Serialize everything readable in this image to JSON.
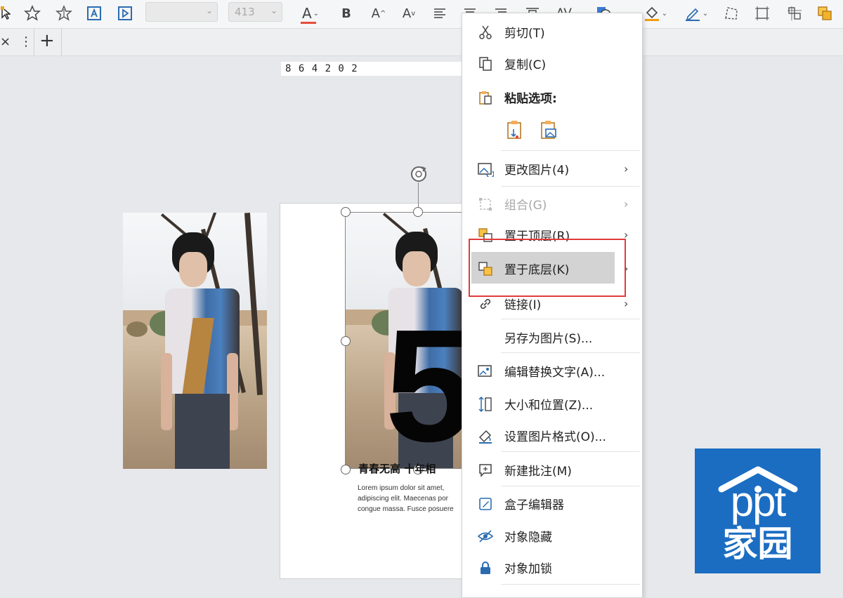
{
  "toolbar": {
    "font_name_value": "",
    "font_size_value": "413",
    "text_color_letter": "A",
    "bold_letter": "B",
    "grow_font_letter": "A",
    "shrink_font_letter": "A",
    "char_spacing_label": "AV",
    "accent_underline_color": "#e74c3c",
    "fill_bar_color": "#f39c12"
  },
  "tabs": {
    "close_glyph": "×",
    "more_glyph": "⋮",
    "add_glyph": "+"
  },
  "ruler": {
    "text": "8 6 4 2 0 2"
  },
  "slide": {
    "big_number": "5",
    "title": "青春无高 十年相",
    "body_lines": [
      "Lorem ipsum dolor sit amet,",
      "adipiscing elit. Maecenas por",
      "congue massa. Fusce posuere"
    ]
  },
  "context_menu": {
    "items": [
      {
        "label": "剪切(T)",
        "icon": "scissors-icon"
      },
      {
        "label": "复制(C)",
        "icon": "copy-icon"
      },
      {
        "label": "粘贴选项:",
        "icon": "paste-icon"
      },
      {
        "label": "更改图片(4)",
        "icon": "change-picture-icon",
        "has_submenu": true
      },
      {
        "label": "组合(G)",
        "icon": "group-icon",
        "has_submenu": true,
        "disabled": true
      },
      {
        "label": "置于顶层(R)",
        "icon": "bring-to-front-icon",
        "has_submenu": true
      },
      {
        "label": "置于底层(K)",
        "icon": "send-to-back-icon",
        "has_submenu": true,
        "highlighted": true
      },
      {
        "label": "链接(I)",
        "icon": "link-icon",
        "has_submenu": true
      },
      {
        "label": "另存为图片(S)...",
        "icon": ""
      },
      {
        "label": "编辑替换文字(A)...",
        "icon": "alt-text-icon"
      },
      {
        "label": "大小和位置(Z)...",
        "icon": "size-position-icon"
      },
      {
        "label": "设置图片格式(O)...",
        "icon": "format-picture-icon"
      },
      {
        "label": "新建批注(M)",
        "icon": "comment-icon"
      },
      {
        "label": "盒子编辑器",
        "icon": "box-editor-icon"
      },
      {
        "label": "对象隐藏",
        "icon": "hide-object-icon"
      },
      {
        "label": "对象加锁",
        "icon": "lock-icon"
      }
    ],
    "highlight_border_color": "#e23b3b"
  },
  "watermark": {
    "line1": "ppt",
    "line2": "家园",
    "bg_color": "#1b6dc2"
  }
}
